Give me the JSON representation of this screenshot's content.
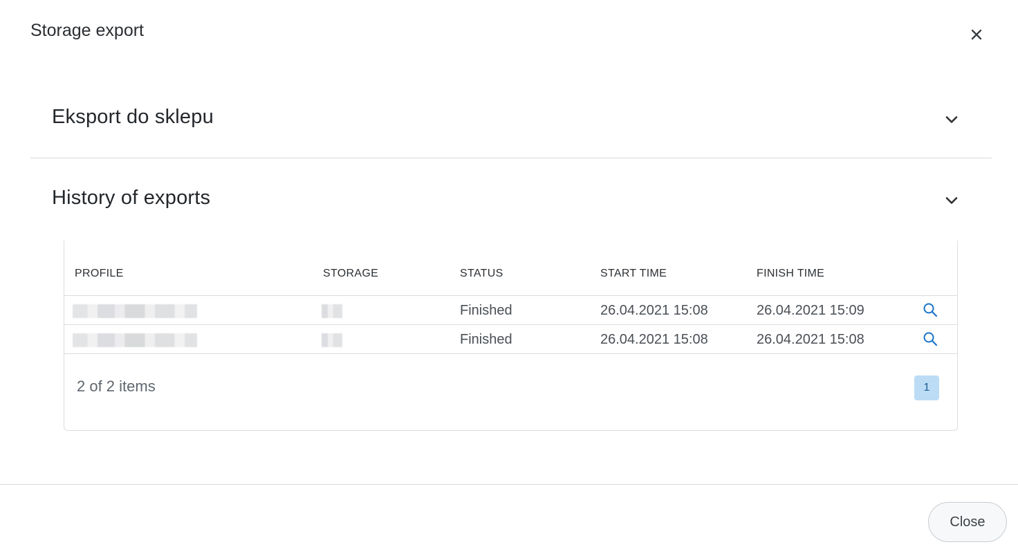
{
  "modal": {
    "title": "Storage export"
  },
  "sections": [
    {
      "title": "Eksport do sklepu"
    },
    {
      "title": "History of exports"
    }
  ],
  "grid": {
    "columns": [
      "PROFILE",
      "STORAGE",
      "STATUS",
      "START TIME",
      "FINISH TIME"
    ],
    "rows": [
      {
        "status": "Finished",
        "start_time": "26.04.2021 15:08",
        "finish_time": "26.04.2021 15:09"
      },
      {
        "status": "Finished",
        "start_time": "26.04.2021 15:08",
        "finish_time": "26.04.2021 15:08"
      }
    ],
    "pager_info": "2 of 2 items",
    "current_page": "1"
  },
  "footer": {
    "close_label": "Close"
  },
  "colors": {
    "accent": "#1a73c9",
    "page_active_bg": "#bcdcf6"
  },
  "icons": {
    "close": "close-icon",
    "chevron": "chevron-down-icon",
    "view": "search-icon"
  }
}
